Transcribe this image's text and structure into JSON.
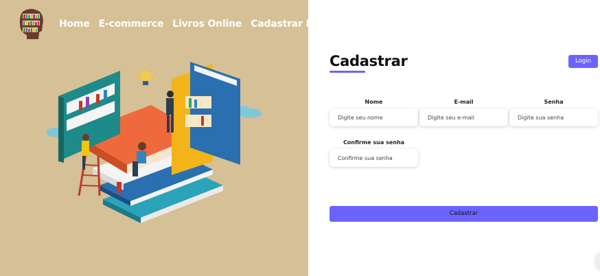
{
  "nav": {
    "items": [
      "Home",
      "E-commerce",
      "Livros Online",
      "Cadastrar Livro"
    ]
  },
  "form": {
    "title": "Cadastrar",
    "login_label": "Login",
    "fields": [
      {
        "label": "Nome",
        "placeholder": "Digite seu nome"
      },
      {
        "label": "E-mail",
        "placeholder": "Digite seu e-mail"
      },
      {
        "label": "Senha",
        "placeholder": "Digite sua senha"
      },
      {
        "label": "Confirme sua senha",
        "placeholder": "Confirme sua senha"
      }
    ],
    "submit_label": "Cadastrar"
  },
  "colors": {
    "accent": "#6c63ff",
    "left_panel": "#d6c095"
  },
  "icons": [
    "book-head-logo-icon",
    "reading-books-illustration"
  ]
}
